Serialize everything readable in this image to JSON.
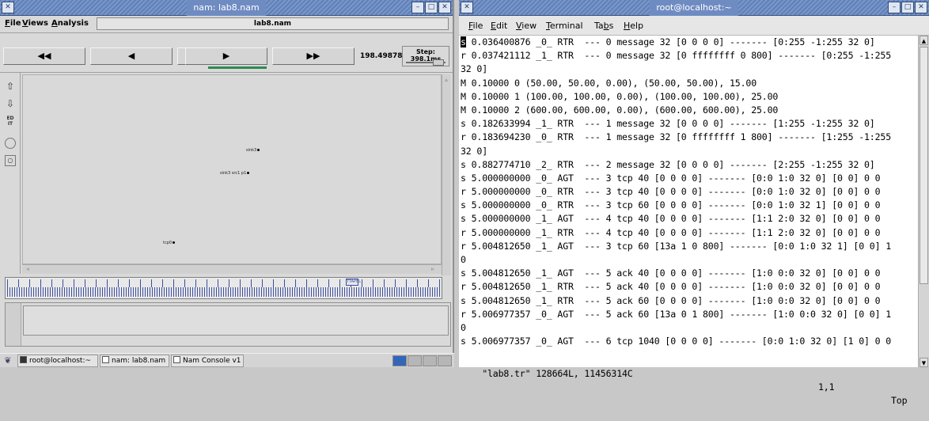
{
  "nam": {
    "title": "nam: lab8.nam",
    "menu": [
      {
        "pre": "",
        "u": "F",
        "post": "ile"
      },
      {
        "pre": "",
        "u": "V",
        "post": "iews"
      },
      {
        "pre": "",
        "u": "A",
        "post": "nalysis"
      }
    ],
    "filename": "lab8.nam",
    "buttons": {
      "rewind": "◀◀",
      "back": "◀",
      "stop": "■",
      "play": "▶",
      "fastforward": "▶▶"
    },
    "time": "198.498787",
    "step": "Step: 398.1ms",
    "nodes": [
      {
        "label": "sink3"
      },
      {
        "label": "sink3 src1 p1"
      },
      {
        "label": "tcp0"
      }
    ],
    "timeline_marker": "TTAPEL"
  },
  "taskbar": {
    "items": [
      {
        "label": "root@localhost:~"
      },
      {
        "label": "nam: lab8.nam"
      },
      {
        "label": "Nam Console v1"
      }
    ]
  },
  "terminal": {
    "title": "root@localhost:~",
    "menu": [
      {
        "pre": "",
        "u": "F",
        "post": "ile"
      },
      {
        "pre": "",
        "u": "E",
        "post": "dit"
      },
      {
        "pre": "",
        "u": "V",
        "post": "iew"
      },
      {
        "pre": "",
        "u": "T",
        "post": "erminal"
      },
      {
        "pre": "Ta",
        "u": "b",
        "post": "s"
      },
      {
        "pre": "",
        "u": "H",
        "post": "elp"
      }
    ],
    "cursor_char": "s",
    "first_line_rest": " 0.036400876 _0_ RTR  --- 0 message 32 [0 0 0 0] ------- [0:255 -1:255 32 0]",
    "lines": [
      "r 0.037421112 _1_ RTR  --- 0 message 32 [0 ffffffff 0 800] ------- [0:255 -1:255",
      "32 0]",
      "M 0.10000 0 (50.00, 50.00, 0.00), (50.00, 50.00), 15.00",
      "M 0.10000 1 (100.00, 100.00, 0.00), (100.00, 100.00), 25.00",
      "M 0.10000 2 (600.00, 600.00, 0.00), (600.00, 600.00), 25.00",
      "s 0.182633994 _1_ RTR  --- 1 message 32 [0 0 0 0] ------- [1:255 -1:255 32 0]",
      "r 0.183694230 _0_ RTR  --- 1 message 32 [0 ffffffff 1 800] ------- [1:255 -1:255",
      "32 0]",
      "s 0.882774710 _2_ RTR  --- 2 message 32 [0 0 0 0] ------- [2:255 -1:255 32 0]",
      "s 5.000000000 _0_ AGT  --- 3 tcp 40 [0 0 0 0] ------- [0:0 1:0 32 0] [0 0] 0 0",
      "r 5.000000000 _0_ RTR  --- 3 tcp 40 [0 0 0 0] ------- [0:0 1:0 32 0] [0 0] 0 0",
      "s 5.000000000 _0_ RTR  --- 3 tcp 60 [0 0 0 0] ------- [0:0 1:0 32 1] [0 0] 0 0",
      "s 5.000000000 _1_ AGT  --- 4 tcp 40 [0 0 0 0] ------- [1:1 2:0 32 0] [0 0] 0 0",
      "r 5.000000000 _1_ RTR  --- 4 tcp 40 [0 0 0 0] ------- [1:1 2:0 32 0] [0 0] 0 0",
      "r 5.004812650 _1_ AGT  --- 3 tcp 60 [13a 1 0 800] ------- [0:0 1:0 32 1] [0 0] 1",
      "0",
      "s 5.004812650 _1_ AGT  --- 5 ack 40 [0 0 0 0] ------- [1:0 0:0 32 0] [0 0] 0 0",
      "r 5.004812650 _1_ RTR  --- 5 ack 40 [0 0 0 0] ------- [1:0 0:0 32 0] [0 0] 0 0",
      "s 5.004812650 _1_ RTR  --- 5 ack 60 [0 0 0 0] ------- [1:0 0:0 32 0] [0 0] 0 0",
      "r 5.006977357 _0_ AGT  --- 5 ack 60 [13a 0 1 800] ------- [1:0 0:0 32 0] [0 0] 1",
      "0",
      "s 5.006977357 _0_ AGT  --- 6 tcp 1040 [0 0 0 0] ------- [0:0 1:0 32 0] [1 0] 0 0"
    ],
    "status_file": "\"lab8.tr\" 128664L, 11456314C",
    "status_pos": "1,1",
    "status_loc": "Top"
  }
}
